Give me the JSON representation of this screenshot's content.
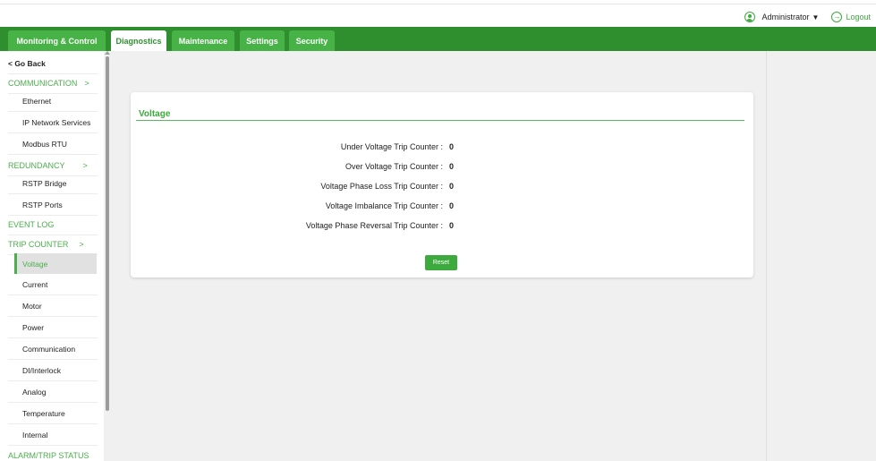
{
  "header": {
    "user_name": "Administrator",
    "caret": "▼",
    "logout_label": "Logout",
    "logout_glyph": "→"
  },
  "nav": {
    "tabs": [
      {
        "label": "Monitoring & Control"
      },
      {
        "label": "Diagnostics",
        "active": true
      },
      {
        "label": "Maintenance"
      },
      {
        "label": "Settings"
      },
      {
        "label": "Security"
      }
    ]
  },
  "sidebar": {
    "back_label": "< Go Back",
    "chevron": ">",
    "items": [
      {
        "label": "COMMUNICATION",
        "type": "section"
      },
      {
        "label": "Ethernet"
      },
      {
        "label": "IP Network Services"
      },
      {
        "label": "Modbus RTU"
      },
      {
        "label": "REDUNDANCY",
        "type": "section"
      },
      {
        "label": "RSTP Bridge"
      },
      {
        "label": "RSTP Ports"
      },
      {
        "label": "EVENT LOG",
        "type": "section"
      },
      {
        "label": "TRIP COUNTER",
        "type": "section"
      },
      {
        "label": "Voltage",
        "selected": true
      },
      {
        "label": "Current"
      },
      {
        "label": "Motor"
      },
      {
        "label": "Power"
      },
      {
        "label": "Communication"
      },
      {
        "label": "DI/Interlock"
      },
      {
        "label": "Analog"
      },
      {
        "label": "Temperature"
      },
      {
        "label": "Internal"
      },
      {
        "label": "ALARM/TRIP STATUS",
        "type": "section"
      }
    ]
  },
  "card": {
    "title": "Voltage",
    "rows": [
      {
        "label": "Under Voltage Trip Counter :",
        "value": "0"
      },
      {
        "label": "Over Voltage Trip Counter :",
        "value": "0"
      },
      {
        "label": "Voltage Phase Loss Trip Counter :",
        "value": "0"
      },
      {
        "label": "Voltage Imbalance Trip Counter :",
        "value": "0"
      },
      {
        "label": "Voltage Phase Reversal Trip Counter :",
        "value": "0"
      }
    ],
    "reset_label": "Reset"
  },
  "colors": {
    "brand_green": "#2f8f2f",
    "accent_green": "#3daa3d",
    "tab_green": "#47b347"
  }
}
